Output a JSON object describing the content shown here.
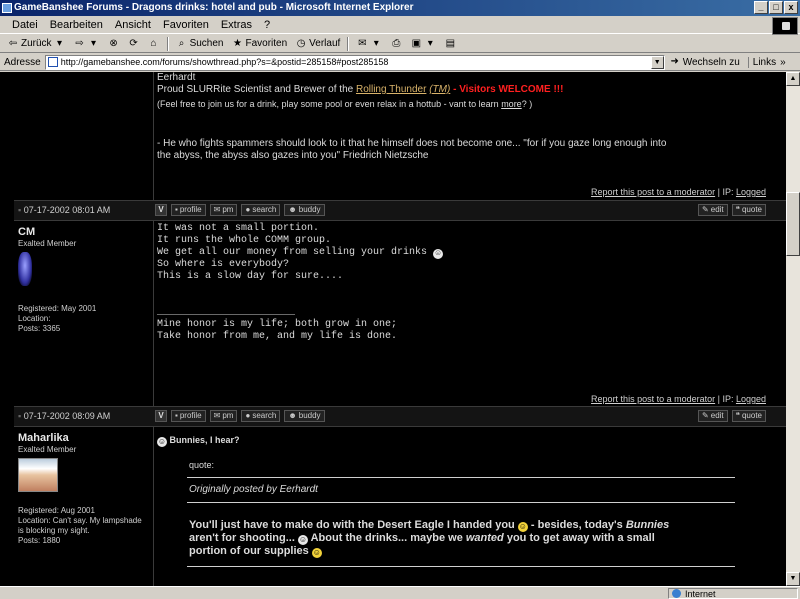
{
  "window": {
    "title": "GameBanshee Forums - Dragons drinks: hotel and pub - Microsoft Internet Explorer",
    "buttons": [
      "_",
      "□",
      "x"
    ]
  },
  "menu": [
    "Datei",
    "Bearbeiten",
    "Ansicht",
    "Favoriten",
    "Extras",
    "?"
  ],
  "toolbar": {
    "back": "Zurück",
    "search": "Suchen",
    "favorites": "Favoriten",
    "history": "Verlauf"
  },
  "address": {
    "label": "Adresse",
    "url": "http://gamebanshee.com/forums/showthread.php?s=&postid=285158#post285158",
    "go": "Wechseln zu",
    "links": "Links"
  },
  "status": {
    "zone": "Internet"
  },
  "post1": {
    "sig_name": "Eerhardt",
    "sig_line_pre": "Proud SLURRite Scientist and Brewer of the ",
    "sig_link": "Rolling Thunder",
    "sig_tm": "(TM)",
    "sig_dash": " - ",
    "sig_welcome": "Visitors WELCOME !!!",
    "sig_small_pre": "(Feel free to join us for a drink, play some pool or even relax in a hottub - vant to learn ",
    "sig_small_link": "more",
    "sig_small_post": "? )",
    "quote_line1": "- He who fights spammers should look to it that he himself does not become one... \"for if you gaze long enough into",
    "quote_line2": "the abyss, the abyss also gazes into you\" Friedrich Nietzsche",
    "report": "Report this post to a moderator",
    "ip_label": " | IP: ",
    "ip_link": "Logged",
    "date": "07-17-2002 08:01 AM"
  },
  "postbar_buttons": {
    "profile": "profile",
    "pm": "pm",
    "search": "search",
    "buddy": "buddy",
    "edit": "edit",
    "quote": "quote"
  },
  "post2": {
    "username": "CM",
    "rank": "Exalted Member",
    "registered": "Registered: May 2001",
    "location": "Location:",
    "posts": "Posts: 3365",
    "lines": [
      "It was not a small portion.",
      "It runs the whole COMM group.",
      "We get all our money from selling your drinks",
      "So where is everybody?",
      "This is a slow day for sure...."
    ],
    "sig_rule": "_______________________",
    "sig_line1": "Mine honor is my life; both grow in one;",
    "sig_line2": "Take honor from me, and my life is done.",
    "report": "Report this post to a moderator",
    "ip_label": " | IP: ",
    "ip_link": "Logged",
    "date": "07-17-2002 08:09 AM"
  },
  "post3": {
    "username": "Maharlika",
    "rank": "Exalted Member",
    "registered": "Registered: Aug 2001",
    "location": "Location: Can't say. My lampshade is blocking my sight.",
    "posts": "Posts: 1880",
    "title": "Bunnies, I hear?",
    "quote_label": "quote:",
    "quote_by": "Originally posted by Eerhardt",
    "body1": "You'll just have to make do with the Desert Eagle I handed you",
    "body2": " - besides, today's ",
    "body_bunnies": "Bunnies",
    "body3": "aren't for shooting...",
    "body4": " About the drinks... maybe we ",
    "body_wanted": "wanted",
    "body5": " you to get away with a small",
    "body6": "portion of our supplies"
  },
  "colors": {
    "background": "#000000",
    "text": "#dcdcdc",
    "link": "#d9b36a",
    "welcome": "#ff2020",
    "titlebar": "#0a246a"
  }
}
